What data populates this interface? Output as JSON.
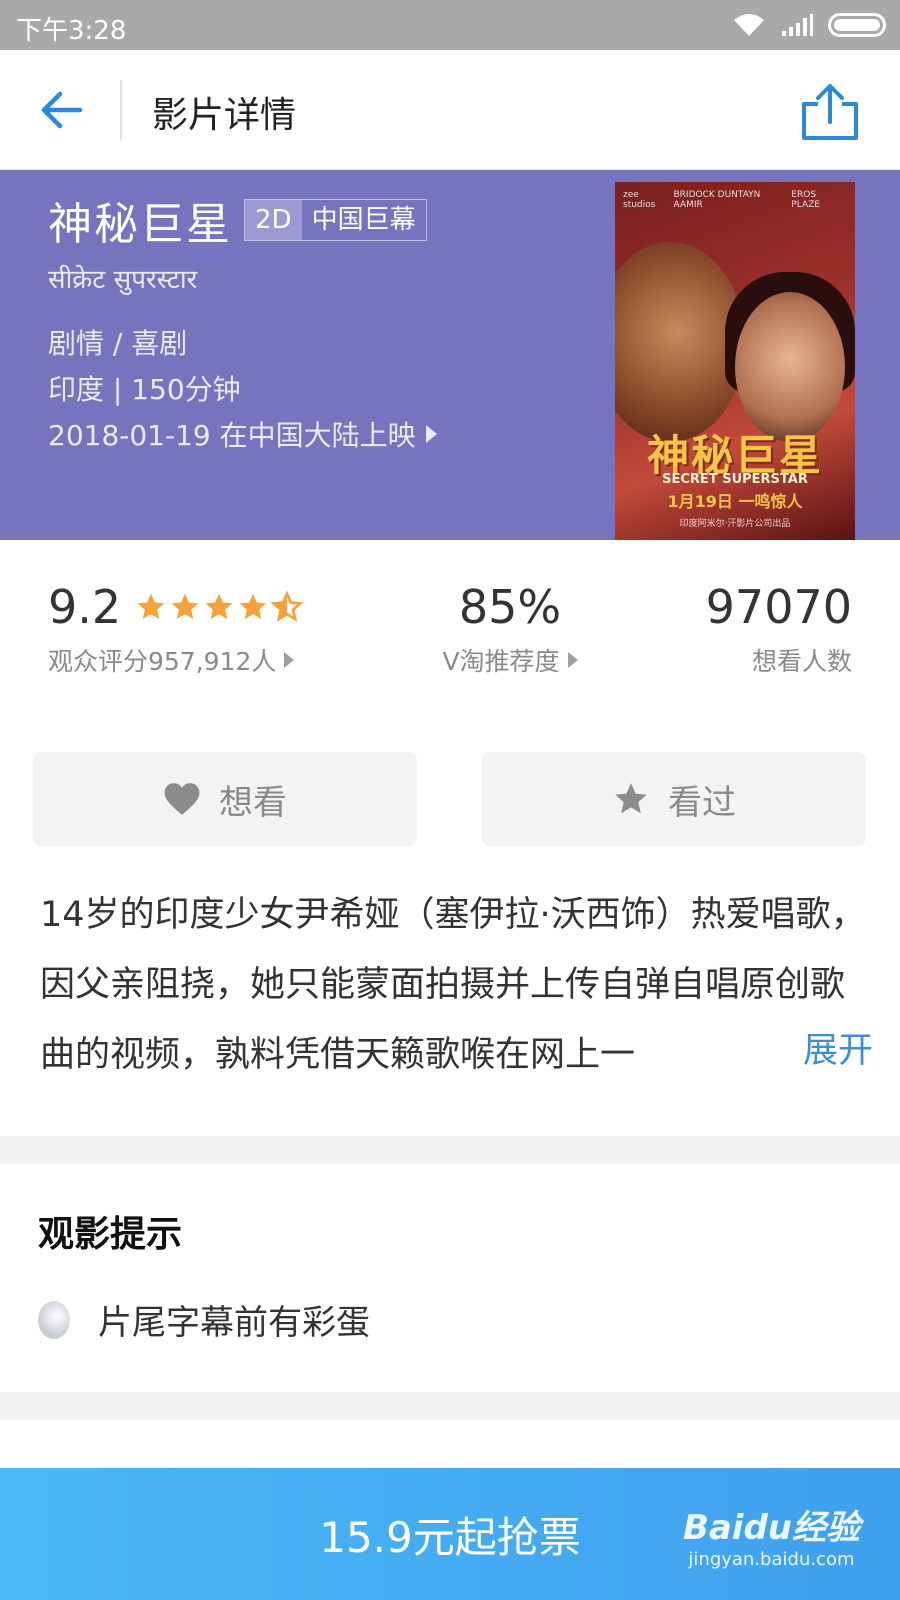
{
  "status_bar": {
    "time": "下午3:28"
  },
  "nav": {
    "title": "影片详情"
  },
  "movie": {
    "title": "神秘巨星",
    "format_tag": "2D",
    "screen_tag": "中国巨幕",
    "alt_title": "सीक्रेट सुपरस्टार",
    "genre": "剧情 / 喜剧",
    "origin_duration": "印度 | 150分钟",
    "release": "2018-01-19 在中国大陆上映",
    "poster": {
      "credits_left": "zee studios",
      "credits_mid": "BRIDOCK  DUNTAYN  AAMIR",
      "credits_right": "EROS  PLAZE",
      "logo": "神秘巨星",
      "subtitle": "SECRET SUPERSTAR",
      "date_line": "1月19日 一鸣惊人",
      "footer": "印度阿米尔·汗影片公司出品"
    }
  },
  "ratings": {
    "score": "9.2",
    "score_stars": 4.5,
    "score_label": "观众评分957,912人",
    "recommend": "85%",
    "recommend_label": "V淘推荐度",
    "want": "97070",
    "want_label": "想看人数"
  },
  "actions": {
    "want_label": "想看",
    "seen_label": "看过"
  },
  "synopsis": {
    "text": "14岁的印度少女尹希娅（塞伊拉·沃西饰）热爱唱歌，因父亲阻挠，她只能蒙面拍摄并上传自弹自唱原创歌曲的视频，孰料凭借天籁歌喉在网上一",
    "expand_label": "展开"
  },
  "tips": {
    "title": "观影提示",
    "item": "片尾字幕前有彩蛋"
  },
  "bottom": {
    "buy_label": "15.9元起抢票",
    "watermark_brand": "Baidu经验",
    "watermark_url": "jingyan.baidu.com"
  },
  "colors": {
    "hero_bg": "#7673bf",
    "accent_blue": "#3a8fd6",
    "star_orange": "#f5a23a",
    "buy_bar": "#42aaf2"
  }
}
